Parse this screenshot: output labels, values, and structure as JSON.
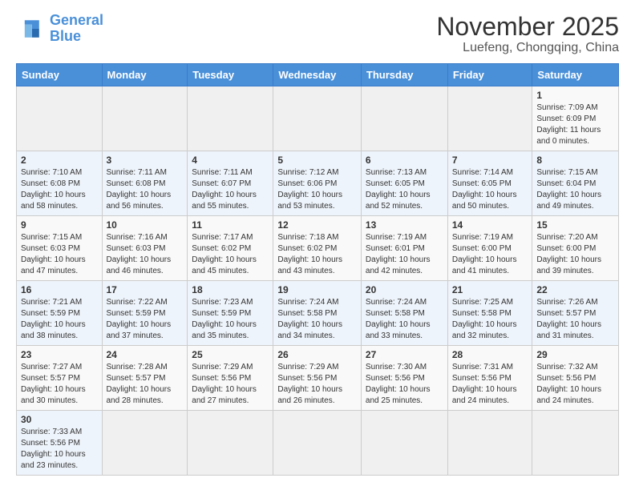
{
  "logo": {
    "line1": "General",
    "line2": "Blue"
  },
  "title": "November 2025",
  "subtitle": "Luefeng, Chongqing, China",
  "days_of_week": [
    "Sunday",
    "Monday",
    "Tuesday",
    "Wednesday",
    "Thursday",
    "Friday",
    "Saturday"
  ],
  "weeks": [
    [
      {
        "num": "",
        "info": ""
      },
      {
        "num": "",
        "info": ""
      },
      {
        "num": "",
        "info": ""
      },
      {
        "num": "",
        "info": ""
      },
      {
        "num": "",
        "info": ""
      },
      {
        "num": "",
        "info": ""
      },
      {
        "num": "1",
        "info": "Sunrise: 7:09 AM\nSunset: 6:09 PM\nDaylight: 11 hours\nand 0 minutes."
      }
    ],
    [
      {
        "num": "2",
        "info": "Sunrise: 7:10 AM\nSunset: 6:08 PM\nDaylight: 10 hours\nand 58 minutes."
      },
      {
        "num": "3",
        "info": "Sunrise: 7:11 AM\nSunset: 6:08 PM\nDaylight: 10 hours\nand 56 minutes."
      },
      {
        "num": "4",
        "info": "Sunrise: 7:11 AM\nSunset: 6:07 PM\nDaylight: 10 hours\nand 55 minutes."
      },
      {
        "num": "5",
        "info": "Sunrise: 7:12 AM\nSunset: 6:06 PM\nDaylight: 10 hours\nand 53 minutes."
      },
      {
        "num": "6",
        "info": "Sunrise: 7:13 AM\nSunset: 6:05 PM\nDaylight: 10 hours\nand 52 minutes."
      },
      {
        "num": "7",
        "info": "Sunrise: 7:14 AM\nSunset: 6:05 PM\nDaylight: 10 hours\nand 50 minutes."
      },
      {
        "num": "8",
        "info": "Sunrise: 7:15 AM\nSunset: 6:04 PM\nDaylight: 10 hours\nand 49 minutes."
      }
    ],
    [
      {
        "num": "9",
        "info": "Sunrise: 7:15 AM\nSunset: 6:03 PM\nDaylight: 10 hours\nand 47 minutes."
      },
      {
        "num": "10",
        "info": "Sunrise: 7:16 AM\nSunset: 6:03 PM\nDaylight: 10 hours\nand 46 minutes."
      },
      {
        "num": "11",
        "info": "Sunrise: 7:17 AM\nSunset: 6:02 PM\nDaylight: 10 hours\nand 45 minutes."
      },
      {
        "num": "12",
        "info": "Sunrise: 7:18 AM\nSunset: 6:02 PM\nDaylight: 10 hours\nand 43 minutes."
      },
      {
        "num": "13",
        "info": "Sunrise: 7:19 AM\nSunset: 6:01 PM\nDaylight: 10 hours\nand 42 minutes."
      },
      {
        "num": "14",
        "info": "Sunrise: 7:19 AM\nSunset: 6:00 PM\nDaylight: 10 hours\nand 41 minutes."
      },
      {
        "num": "15",
        "info": "Sunrise: 7:20 AM\nSunset: 6:00 PM\nDaylight: 10 hours\nand 39 minutes."
      }
    ],
    [
      {
        "num": "16",
        "info": "Sunrise: 7:21 AM\nSunset: 5:59 PM\nDaylight: 10 hours\nand 38 minutes."
      },
      {
        "num": "17",
        "info": "Sunrise: 7:22 AM\nSunset: 5:59 PM\nDaylight: 10 hours\nand 37 minutes."
      },
      {
        "num": "18",
        "info": "Sunrise: 7:23 AM\nSunset: 5:59 PM\nDaylight: 10 hours\nand 35 minutes."
      },
      {
        "num": "19",
        "info": "Sunrise: 7:24 AM\nSunset: 5:58 PM\nDaylight: 10 hours\nand 34 minutes."
      },
      {
        "num": "20",
        "info": "Sunrise: 7:24 AM\nSunset: 5:58 PM\nDaylight: 10 hours\nand 33 minutes."
      },
      {
        "num": "21",
        "info": "Sunrise: 7:25 AM\nSunset: 5:58 PM\nDaylight: 10 hours\nand 32 minutes."
      },
      {
        "num": "22",
        "info": "Sunrise: 7:26 AM\nSunset: 5:57 PM\nDaylight: 10 hours\nand 31 minutes."
      }
    ],
    [
      {
        "num": "23",
        "info": "Sunrise: 7:27 AM\nSunset: 5:57 PM\nDaylight: 10 hours\nand 30 minutes."
      },
      {
        "num": "24",
        "info": "Sunrise: 7:28 AM\nSunset: 5:57 PM\nDaylight: 10 hours\nand 28 minutes."
      },
      {
        "num": "25",
        "info": "Sunrise: 7:29 AM\nSunset: 5:56 PM\nDaylight: 10 hours\nand 27 minutes."
      },
      {
        "num": "26",
        "info": "Sunrise: 7:29 AM\nSunset: 5:56 PM\nDaylight: 10 hours\nand 26 minutes."
      },
      {
        "num": "27",
        "info": "Sunrise: 7:30 AM\nSunset: 5:56 PM\nDaylight: 10 hours\nand 25 minutes."
      },
      {
        "num": "28",
        "info": "Sunrise: 7:31 AM\nSunset: 5:56 PM\nDaylight: 10 hours\nand 24 minutes."
      },
      {
        "num": "29",
        "info": "Sunrise: 7:32 AM\nSunset: 5:56 PM\nDaylight: 10 hours\nand 24 minutes."
      }
    ],
    [
      {
        "num": "30",
        "info": "Sunrise: 7:33 AM\nSunset: 5:56 PM\nDaylight: 10 hours\nand 23 minutes."
      },
      {
        "num": "",
        "info": ""
      },
      {
        "num": "",
        "info": ""
      },
      {
        "num": "",
        "info": ""
      },
      {
        "num": "",
        "info": ""
      },
      {
        "num": "",
        "info": ""
      },
      {
        "num": "",
        "info": ""
      }
    ]
  ]
}
